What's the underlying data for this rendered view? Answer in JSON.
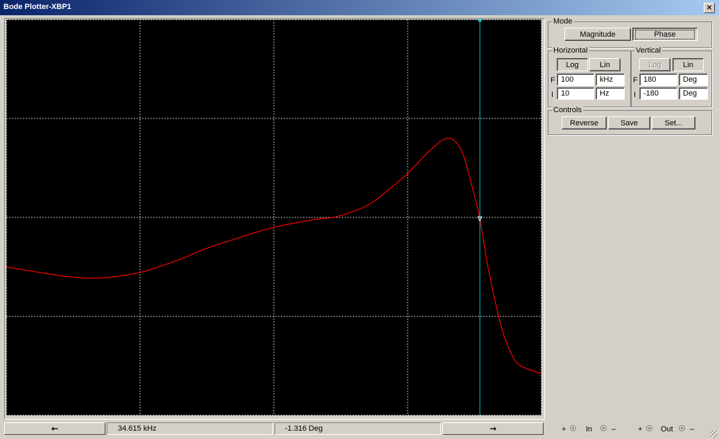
{
  "window": {
    "title": "Bode Plotter-XBP1",
    "close": "×"
  },
  "mode": {
    "label": "Mode",
    "magnitude": "Magnitude",
    "phase": "Phase",
    "selected": "Phase"
  },
  "horizontal": {
    "label": "Horizontal",
    "log": "Log",
    "lin": "Lin",
    "scale_selected": "Log",
    "f_label": "F",
    "f_value": "100",
    "f_unit": "kHz",
    "i_label": "I",
    "i_value": "10",
    "i_unit": "Hz"
  },
  "vertical": {
    "label": "Vertical",
    "log": "Log",
    "lin": "Lin",
    "scale_selected": "Lin",
    "f_label": "F",
    "f_value": "180",
    "f_unit": "Deg",
    "i_label": "I",
    "i_value": "-180",
    "i_unit": "Deg"
  },
  "controls": {
    "label": "Controls",
    "reverse": "Reverse",
    "save": "Save",
    "set": "Set..."
  },
  "status": {
    "left_arrow": "←",
    "right_arrow": "→",
    "frequency": "34.615 kHz",
    "phase": "-1.316 Deg"
  },
  "terminals": {
    "in_label": "In",
    "out_label": "Out",
    "plus": "+",
    "minus": "–"
  },
  "chart_data": {
    "type": "line",
    "x_scale": "log",
    "xlim": [
      10,
      100000
    ],
    "ylim": [
      -180,
      180
    ],
    "x_unit": "Hz",
    "y_unit": "Deg",
    "grid": true,
    "background": "#000000",
    "grid_color": "#c8c8c8",
    "trace_color": "#ff0000",
    "cursor_color": "#00c8c8",
    "cursor": {
      "x": 34615,
      "y": -1.316
    },
    "series": [
      {
        "x": [
          10,
          20,
          30,
          50,
          100,
          200,
          300,
          500,
          1000,
          2000,
          3000,
          5000,
          7000,
          10000,
          15000,
          20000,
          25000,
          30000,
          34615,
          40000,
          50000,
          60000,
          70000,
          100000
        ],
        "y": [
          -45,
          -51,
          -54,
          -55,
          -50,
          -38,
          -29,
          -20,
          -9,
          -2,
          1,
          11,
          24,
          40,
          62,
          72,
          62,
          30,
          -1.3,
          -46,
          -99,
          -125,
          -135,
          -142
        ]
      }
    ]
  }
}
